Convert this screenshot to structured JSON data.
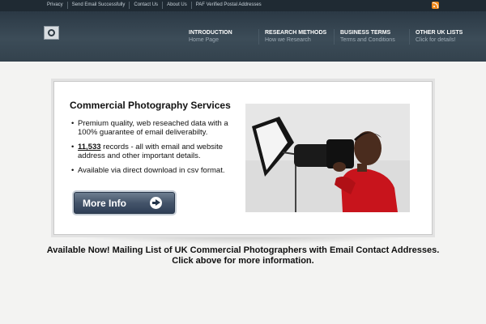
{
  "top_links": [
    "Privacy",
    "Send Email Successfully",
    "Contact Us",
    "About Us",
    "PAF Verified Postal Addresses"
  ],
  "icons": {
    "rss": "rss-icon",
    "logo": "site-logo-icon",
    "arrow": "arrow-right-circle-icon"
  },
  "nav": [
    {
      "title": "INTRODUCTION",
      "subtitle": "Home Page"
    },
    {
      "title": "RESEARCH METHODS",
      "subtitle": "How we Research"
    },
    {
      "title": "BUSINESS TERMS",
      "subtitle": "Terms and Conditions"
    },
    {
      "title": "OTHER UK LISTS",
      "subtitle": "Click for details!"
    }
  ],
  "banner": {
    "title": "Commercial Photography Services",
    "bullet1": "Premium quality, web reseached data with a 100% guarantee of email deliverabilty.",
    "record_count": "11,533",
    "bullet2_rest": " records - all with email and website address and other important details.",
    "bullet3": "Available via direct download in csv format.",
    "button_label": "More Info"
  },
  "caption": {
    "line1": "Available Now! Mailing List of UK  Commercial Photographers with Email Contact Addresses.",
    "line2": "Click above for more information."
  },
  "colors": {
    "header_bg": "#33424d",
    "topbar_bg": "#1f2a33",
    "rss": "#f08a1c",
    "photographer_shirt": "#c8141c"
  }
}
